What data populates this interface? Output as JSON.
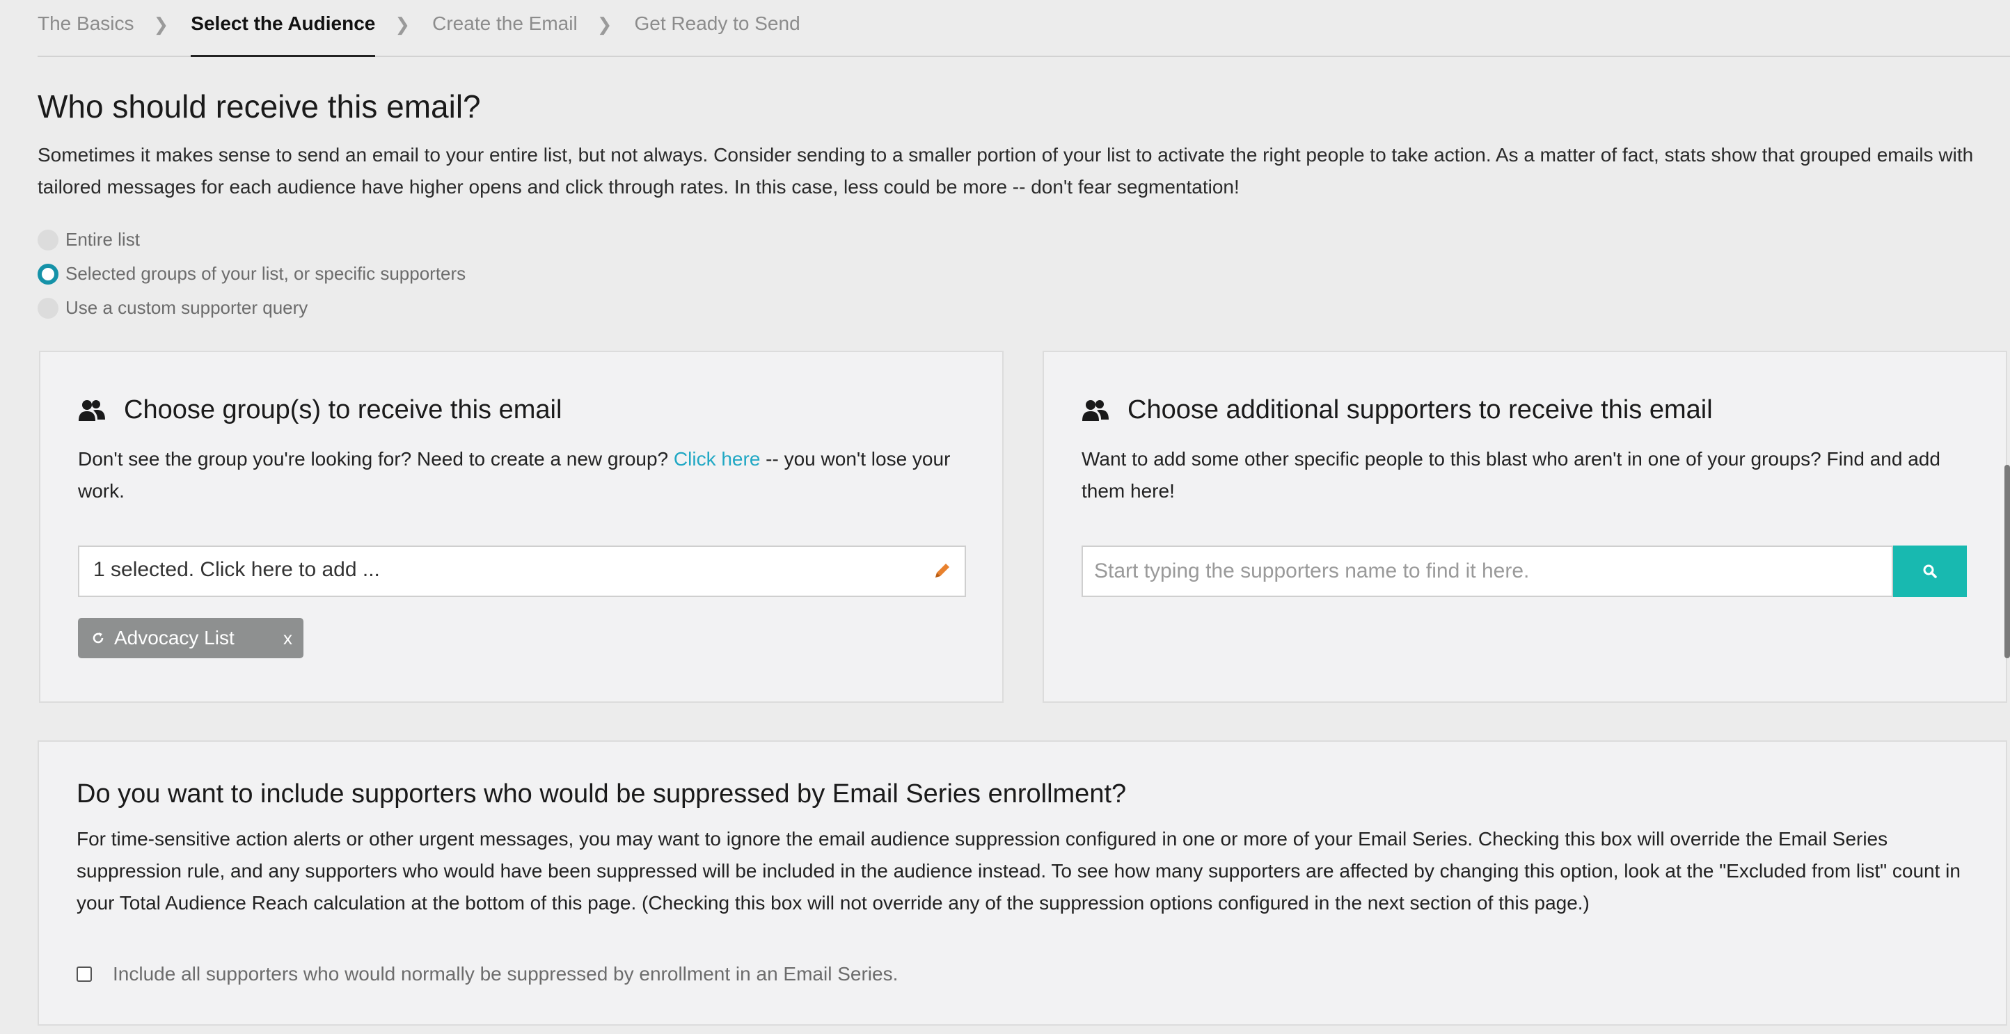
{
  "breadcrumb": [
    {
      "label": "The Basics",
      "active": false
    },
    {
      "label": "Select the Audience",
      "active": true
    },
    {
      "label": "Create the Email",
      "active": false
    },
    {
      "label": "Get Ready to Send",
      "active": false
    }
  ],
  "breadcrumb_separator": "❯",
  "page_title": "Who should receive this email?",
  "intro": "Sometimes it makes sense to send an email to your entire list, but not always. Consider sending to a smaller portion of your list to activate the right people to take action. As a matter of fact, stats show that grouped emails with tailored messages for each audience have higher opens and click through rates. In this case, less could be more -- don't fear segmentation!",
  "audience_options": [
    {
      "label": "Entire list",
      "checked": false
    },
    {
      "label": "Selected groups of your list, or specific supporters",
      "checked": true
    },
    {
      "label": "Use a custom supporter query",
      "checked": false
    }
  ],
  "groups_panel": {
    "icon": "people-icon",
    "title": "Choose group(s) to receive this email",
    "text_before": "Don't see the group you're looking for? Need to create a new group? ",
    "link": "Click here",
    "text_after": " -- you won't lose your work.",
    "select_value": "1 selected. Click here to add ...",
    "edit_icon": "pencil-icon",
    "tag_icon": "refresh-icon",
    "tag": "Advocacy List",
    "tag_remove": "x"
  },
  "supporters_panel": {
    "icon": "people-icon",
    "title": "Choose additional supporters to receive this email",
    "text": "Want to add some other specific people to this blast who aren't in one of your groups? Find and add them here!",
    "search_placeholder": "Start typing the supporters name to find it here.",
    "search_icon": "search-icon"
  },
  "suppression": {
    "title": "Do you want to include supporters who would be suppressed by Email Series enrollment?",
    "text": "For time-sensitive action alerts or other urgent messages, you may want to ignore the email audience suppression configured in one or more of your Email Series. Checking this box will override the Email Series suppression rule, and any supporters who would have been suppressed will be included in the audience instead. To see how many supporters are affected by changing this option, look at the \"Excluded from list\" count in your Total Audience Reach calculation at the bottom of this page. (Checking this box will not override any of the suppression options configured in the next section of this page.)",
    "checkbox_label": "Include all supporters who would normally be suppressed by enrollment in an Email Series.",
    "checked": false
  },
  "colors": {
    "accent": "#1592a8",
    "link": "#21a8c4",
    "search_button": "#18b9b0",
    "pencil": "#e8812e",
    "tag": "#8e9090"
  }
}
